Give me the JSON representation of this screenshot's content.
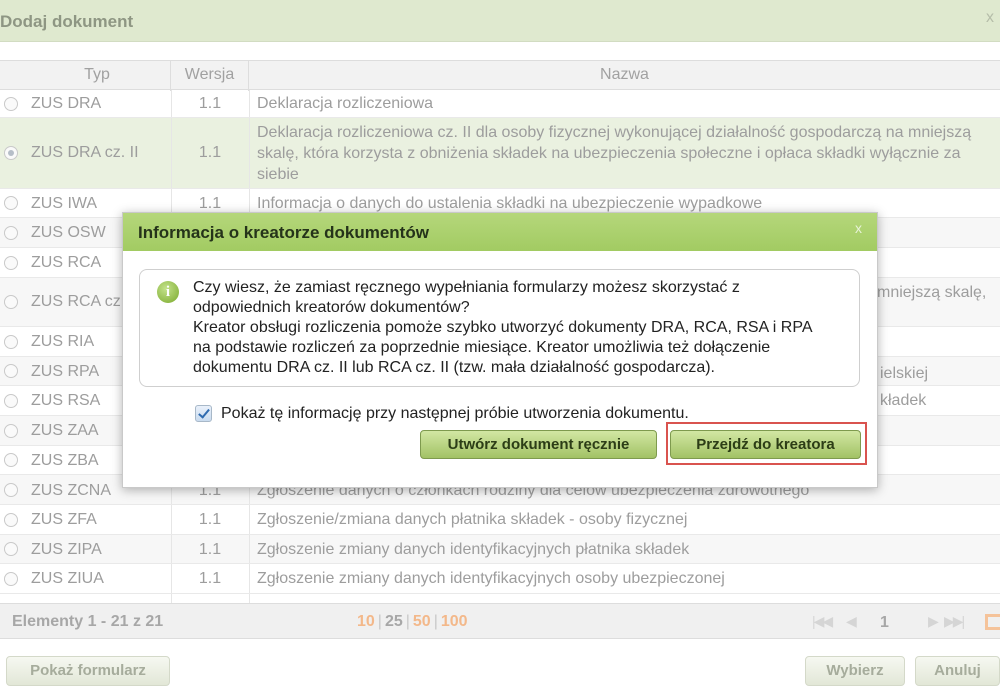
{
  "window": {
    "title": "Dodaj dokument",
    "close": "x"
  },
  "table": {
    "headers": {
      "type": "Typ",
      "version": "Wersja",
      "name": "Nazwa"
    },
    "rows": [
      {
        "type": "ZUS DRA",
        "version": "1.1",
        "name": "Deklaracja rozliczeniowa"
      },
      {
        "type": "ZUS DRA cz. II",
        "version": "1.1",
        "name": "Deklaracja rozliczeniowa cz. II dla osoby fizycznej wykonującej działalność gospodarczą na mniejszą skalę, która korzysta z obniżenia składek na ubezpieczenia społeczne i opłaca składki wyłącznie za siebie",
        "selected": true
      },
      {
        "type": "ZUS IWA",
        "version": "1.1",
        "name": "Informacja o danych do ustalenia składki na ubezpieczenie wypadkowe"
      },
      {
        "type": "ZUS OSW",
        "version": "",
        "name": ""
      },
      {
        "type": "ZUS RCA",
        "version": "",
        "name": ""
      },
      {
        "type": "ZUS RCA cz",
        "version": "",
        "name": "mniejszą skalę,"
      },
      {
        "type": "ZUS RIA",
        "version": "",
        "name": ""
      },
      {
        "type": "ZUS RPA",
        "version": "",
        "name": "ielskiej"
      },
      {
        "type": "ZUS RSA",
        "version": "",
        "name": "kładek"
      },
      {
        "type": "ZUS ZAA",
        "version": "",
        "name": ""
      },
      {
        "type": "ZUS ZBA",
        "version": "",
        "name": ""
      },
      {
        "type": "ZUS ZCNA",
        "version": "1.1",
        "name": "Zgłoszenie danych o członkach rodziny dla celów ubezpieczenia zdrowotnego"
      },
      {
        "type": "ZUS ZFA",
        "version": "1.1",
        "name": "Zgłoszenie/zmiana danych płatnika składek - osoby fizycznej"
      },
      {
        "type": "ZUS ZIPA",
        "version": "1.1",
        "name": "Zgłoszenie zmiany danych identyfikacyjnych płatnika składek"
      },
      {
        "type": "ZUS ZIUA",
        "version": "1.1",
        "name": "Zgłoszenie zmiany danych identyfikacyjnych osoby ubezpieczonej"
      }
    ]
  },
  "pager": {
    "elements_text": "Elementy 1 - 21 z 21",
    "sizes": [
      "10",
      "25",
      "50",
      "100"
    ],
    "current_size": "25",
    "first": "|◀◀",
    "prev": "◀",
    "page": "1",
    "next": "▶",
    "last": "▶▶|"
  },
  "buttons": {
    "show_form": "Pokaż formularz",
    "choose": "Wybierz",
    "cancel": "Anuluj"
  },
  "modal": {
    "title": "Informacja o kreatorze dokumentów",
    "close": "x",
    "info_icon": "i",
    "lines": [
      "Czy wiesz, że zamiast ręcznego wypełniania formularzy możesz skorzystać z",
      "odpowiednich kreatorów dokumentów?",
      "Kreator obsługi rozliczenia pomoże szybko utworzyć dokumenty DRA, RCA, RSA i RPA",
      "na podstawie rozliczeń za poprzednie miesiące. Kreator umożliwia też dołączenie",
      "dokumentu DRA cz. II lub RCA cz. II (tzw. mała działalność gospodarcza)."
    ],
    "checkbox_label": "Pokaż tę informację przy następnej próbie utworzenia dokumentu.",
    "checkbox_checked": true,
    "btn_manual": "Utwórz dokument ręcznie",
    "btn_wizard": "Przejdź do kreatora"
  },
  "colors": {
    "accent_green": "#a2cb62",
    "highlight_red": "#d9534f"
  }
}
